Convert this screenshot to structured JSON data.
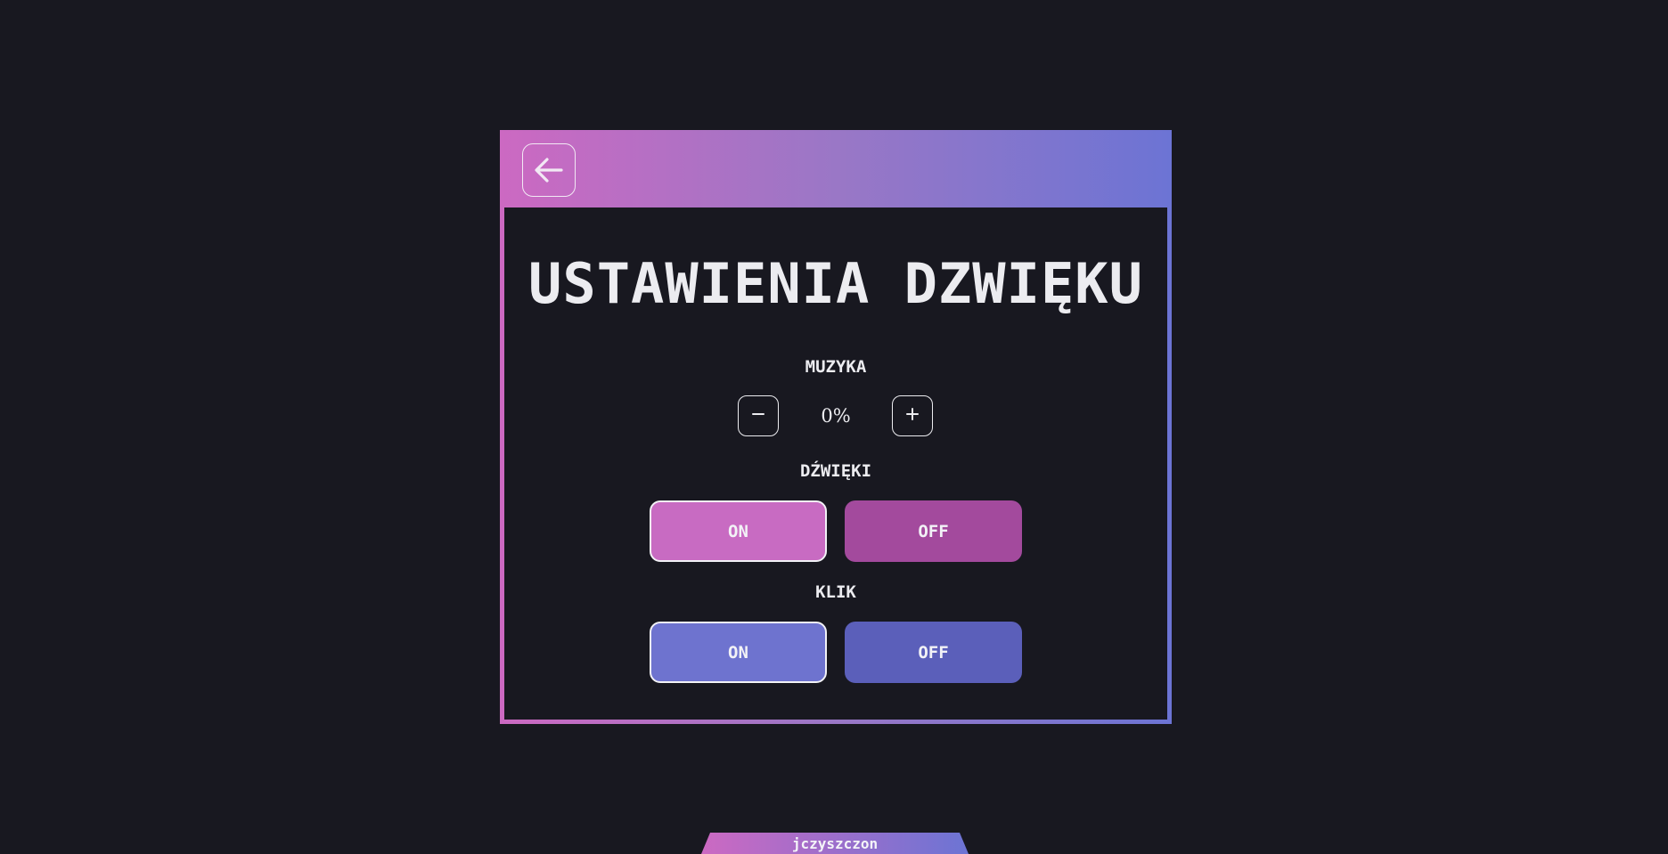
{
  "header": {
    "back_icon": "arrow-left-icon"
  },
  "title": "USTAWIENIA DZWIĘKU",
  "music": {
    "label": "MUZYKA",
    "value": "0%",
    "decrease_symbol": "−",
    "increase_symbol": "+"
  },
  "sounds": {
    "label": "DŹWIĘKI",
    "on_label": "ON",
    "off_label": "OFF",
    "selected": "ON",
    "on_color": "#c86bc2",
    "off_color": "#a34a9d"
  },
  "click": {
    "label": "KLIK",
    "on_label": "ON",
    "off_label": "OFF",
    "selected": "ON",
    "on_color": "#6e73cf",
    "off_color": "#5b5fba"
  },
  "footer": {
    "author": "jczyszczon"
  },
  "colors": {
    "background": "#181820",
    "gradient_start": "#cc69c2",
    "gradient_end": "#6c74d4",
    "text": "#ececf0"
  }
}
